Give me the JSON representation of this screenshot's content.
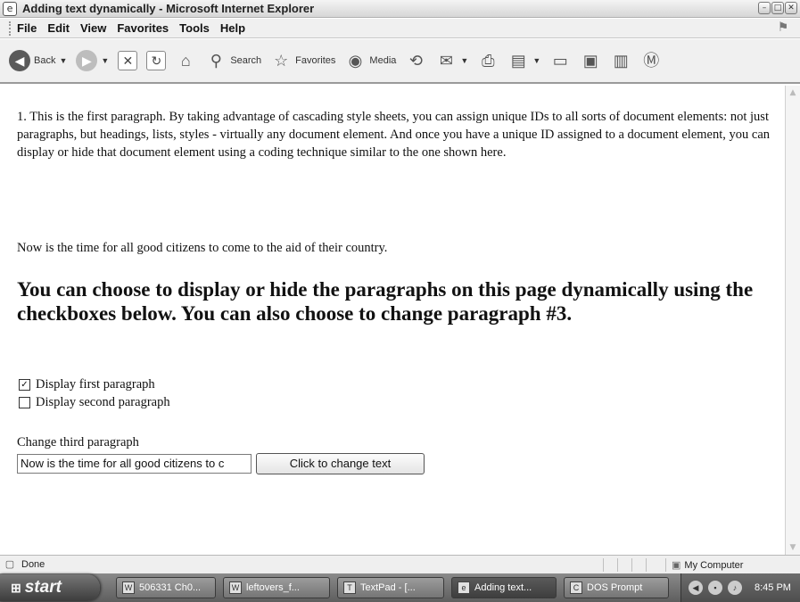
{
  "window": {
    "title": "Adding text dynamically - Microsoft Internet Explorer",
    "min_glyph": "–",
    "max_glyph": "□",
    "close_glyph": "✕"
  },
  "menu": [
    "File",
    "Edit",
    "View",
    "Favorites",
    "Tools",
    "Help"
  ],
  "toolbar": {
    "back_label": "Back",
    "search_label": "Search",
    "favorites_label": "Favorites",
    "media_label": "Media"
  },
  "content": {
    "paragraph1": "1. This is the first paragraph. By taking advantage of cascading style sheets, you can assign unique IDs to all sorts of document elements: not just paragraphs, but headings, lists, styles - virtually any document element. And once you have a unique ID assigned to a document element, you can display or hide that document element using a coding technique similar to the one shown here.",
    "paragraph2": "Now is the time for all good citizens to come to the aid of their country.",
    "heading": "You can choose to display or hide the paragraphs on this page dynamically using the checkboxes below. You can also choose to change paragraph #3.",
    "checkbox1": {
      "label": "Display first paragraph",
      "checked": true
    },
    "checkbox2": {
      "label": "Display second paragraph",
      "checked": false
    },
    "change_label": "Change third paragraph",
    "input_value": "Now is the time for all good citizens to c",
    "button_label": "Click to change text"
  },
  "status": {
    "text": "Done",
    "zone": "My Computer"
  },
  "taskbar": {
    "start_label": "start",
    "tasks": [
      "506331 Ch0...",
      "leftovers_f...",
      "TextPad - [...",
      "Adding text...",
      "DOS Prompt"
    ],
    "active_task": 3,
    "clock": "8:45 PM"
  }
}
